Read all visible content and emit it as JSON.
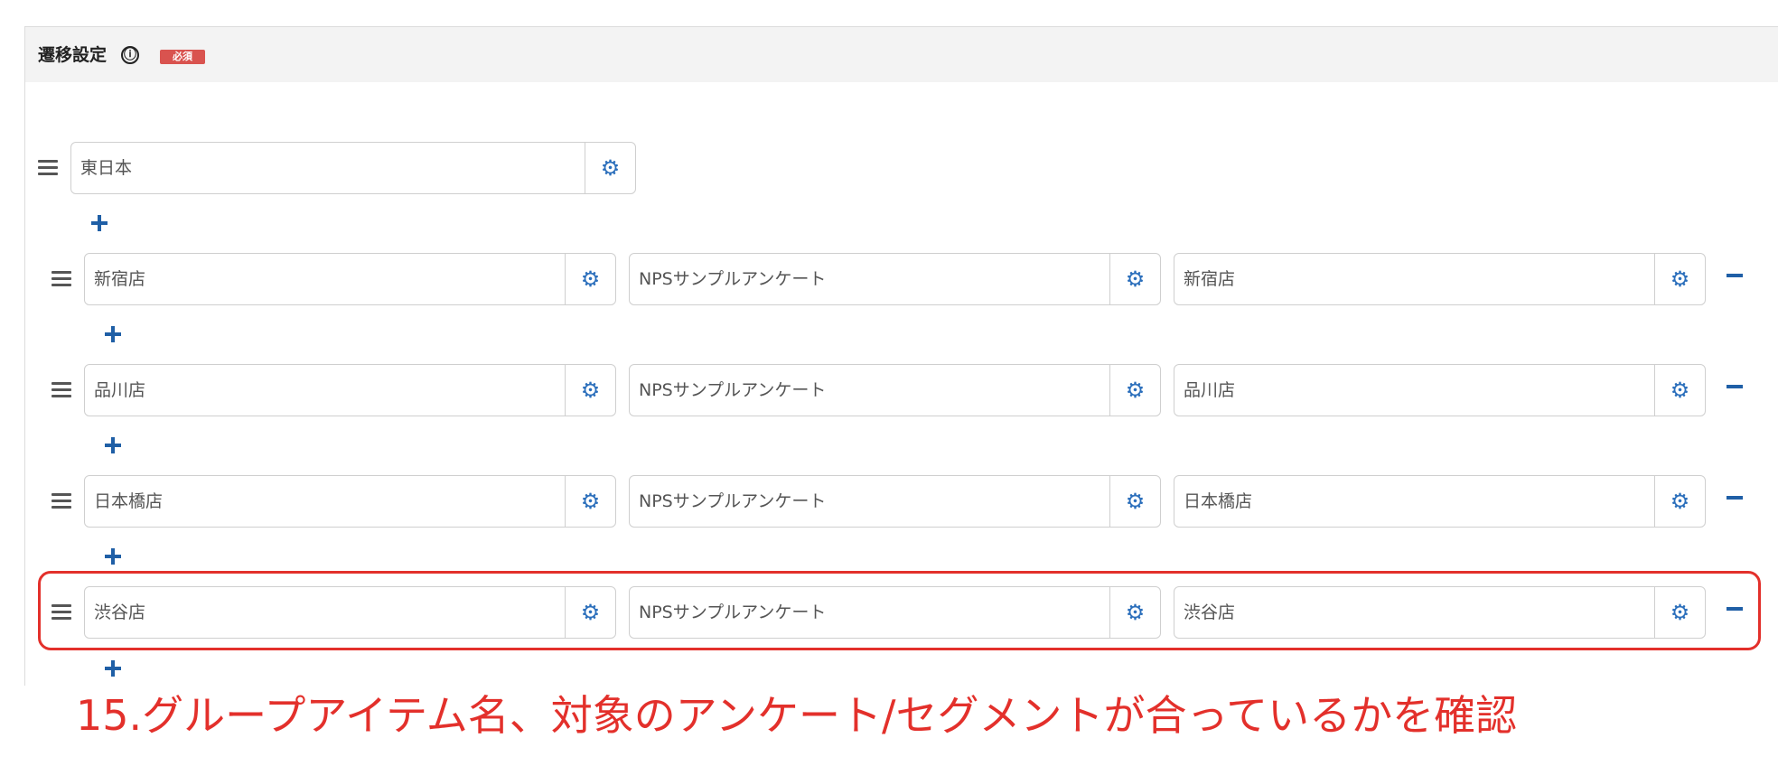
{
  "header": {
    "title": "遷移設定",
    "info_icon": "ⓘ",
    "required_badge": "必須"
  },
  "icons": {
    "gear": "gear-icon",
    "drag": "drag-handle-icon",
    "add": "plus-icon",
    "remove": "minus-icon"
  },
  "root": {
    "name": "東日本",
    "gear_glyph": "⚙"
  },
  "rows": [
    {
      "name": "新宿店",
      "survey": "NPSサンプルアンケート",
      "segment": "新宿店"
    },
    {
      "name": "品川店",
      "survey": "NPSサンプルアンケート",
      "segment": "品川店"
    },
    {
      "name": "日本橋店",
      "survey": "NPSサンプルアンケート",
      "segment": "日本橋店"
    },
    {
      "name": "渋谷店",
      "survey": "NPSサンプルアンケート",
      "segment": "渋谷店"
    }
  ],
  "annotation": {
    "text": "15.グループアイテム名、対象のアンケート/セグメントが合っているかを確認",
    "color": "#e3302b"
  },
  "colors": {
    "accent": "#2a6ebb",
    "required": "#d9534f"
  }
}
